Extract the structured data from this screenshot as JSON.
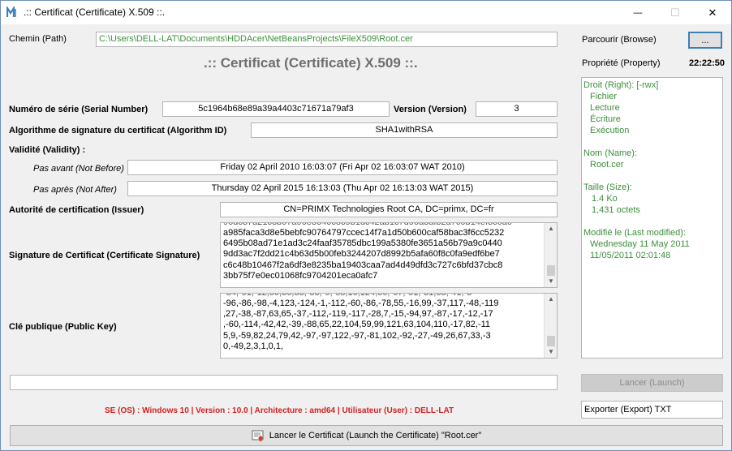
{
  "window": {
    "title": ".:: Certificat (Certificate) X.509 ::.",
    "minimize": "—",
    "maximize": "☐",
    "close": "✕"
  },
  "path": {
    "label": "Chemin (Path)",
    "value": "C:\\Users\\DELL-LAT\\Documents\\HDDAcer\\NetBeansProjects\\FileX509\\Root.cer"
  },
  "heading": ".:: Certificat (Certificate) X.509 ::.",
  "fields": {
    "serial_label": "Numéro de série (Serial Number)",
    "serial_value": "5c1964b68e89a39a4403c71671a79af3",
    "version_label": "Version (Version)",
    "version_value": "3",
    "algorithm_label": "Algorithme de signature du certificat (Algorithm ID)",
    "algorithm_value": "SHA1withRSA",
    "validity_label": "Validité (Validity) :",
    "not_before_label": "Pas avant (Not Before)",
    "not_before_value": "Friday 02 April 2010 16:03:07 (Fri Apr 02 16:03:07 WAT 2010)",
    "not_after_label": "Pas après (Not After)",
    "not_after_value": "Thursday 02 April 2015 16:13:03 (Thu Apr 02 16:13:03 WAT 2015)",
    "issuer_label": "Autorité de certification (Issuer)",
    "issuer_value": "CN=PRIMX Technologies Root CA, DC=primx, DC=fr",
    "signature_label": "Signature de Certificat (Certificate Signature)",
    "signature_lines": [
      "a985faca3d8e5bebfc90764797ccec14f7a1d50b600caf58bac3f6cc5232",
      "6495b08ad71e1ad3c24faaf35785dbc199a5380fe3651a56b79a9c0440",
      "9dd3ac7f2dd21c4b63d5b00feb3244207d8992b5afa60f8c0fa9edf6be7",
      "c6c48b10467f2a6df3e8235ba19403caa7ad4d49dfd3c727c6bfd37cbc8",
      "3bb75f7e0ec01068fc9704201eca0afc7"
    ],
    "pubkey_label": "Clé publique (Public Key)",
    "pubkey_lines": [
      "-96,-86,-98,-4,123,-124,-1,-112,-60,-86,-78,55,-16,99,-37,117,-48,-119",
      ",27,-38,-87,63,65,-37,-112,-119,-117,-28,7,-15,-94,97,-87,-17,-12,-17",
      ",-60,-114,-42,42,-39,-88,65,22,104,59,99,121,63,104,110,-17,82,-11",
      "5,9,-59,82,24,79,42,-97,-97,122,-97,-81,102,-92,-27,-49,26,67,33,-3",
      "0,-49,2,3,1,0,1,"
    ]
  },
  "sidebar": {
    "browse_label": "Parcourir (Browse)",
    "browse_button": "...",
    "property_label": "Propriété (Property)",
    "clock": "22:22:50",
    "rights_header": "Droit (Right): [-rwx]",
    "rights": [
      "Fichier",
      "Lecture",
      "Écriture",
      "Exécution"
    ],
    "name_header": "Nom (Name):",
    "name_value": "Root.cer",
    "size_header": "Taille (Size):",
    "size_kb": "1.4 Ko",
    "size_bytes": "1,431 octets",
    "modified_header": "Modifié le (Last modified):",
    "modified_date": "Wednesday 11 May 2011",
    "modified_datetime": "11/05/2011 02:01:48",
    "launch_button": "Lancer (Launch)",
    "export_selected": "Exporter (Export) TXT"
  },
  "status": {
    "os_info": "SE (OS) : Windows 10 | Version : 10.0 | Architecture : amd64 | Utilisateur (User) : DELL-LAT"
  },
  "footer": {
    "launch_cert_button": "Lancer le Certificat (Launch the Certificate)  \"Root.cer\""
  },
  "colors": {
    "accent_green": "#3c8f3c",
    "heading_grey": "#6e6e6e",
    "os_red": "#d42020"
  }
}
